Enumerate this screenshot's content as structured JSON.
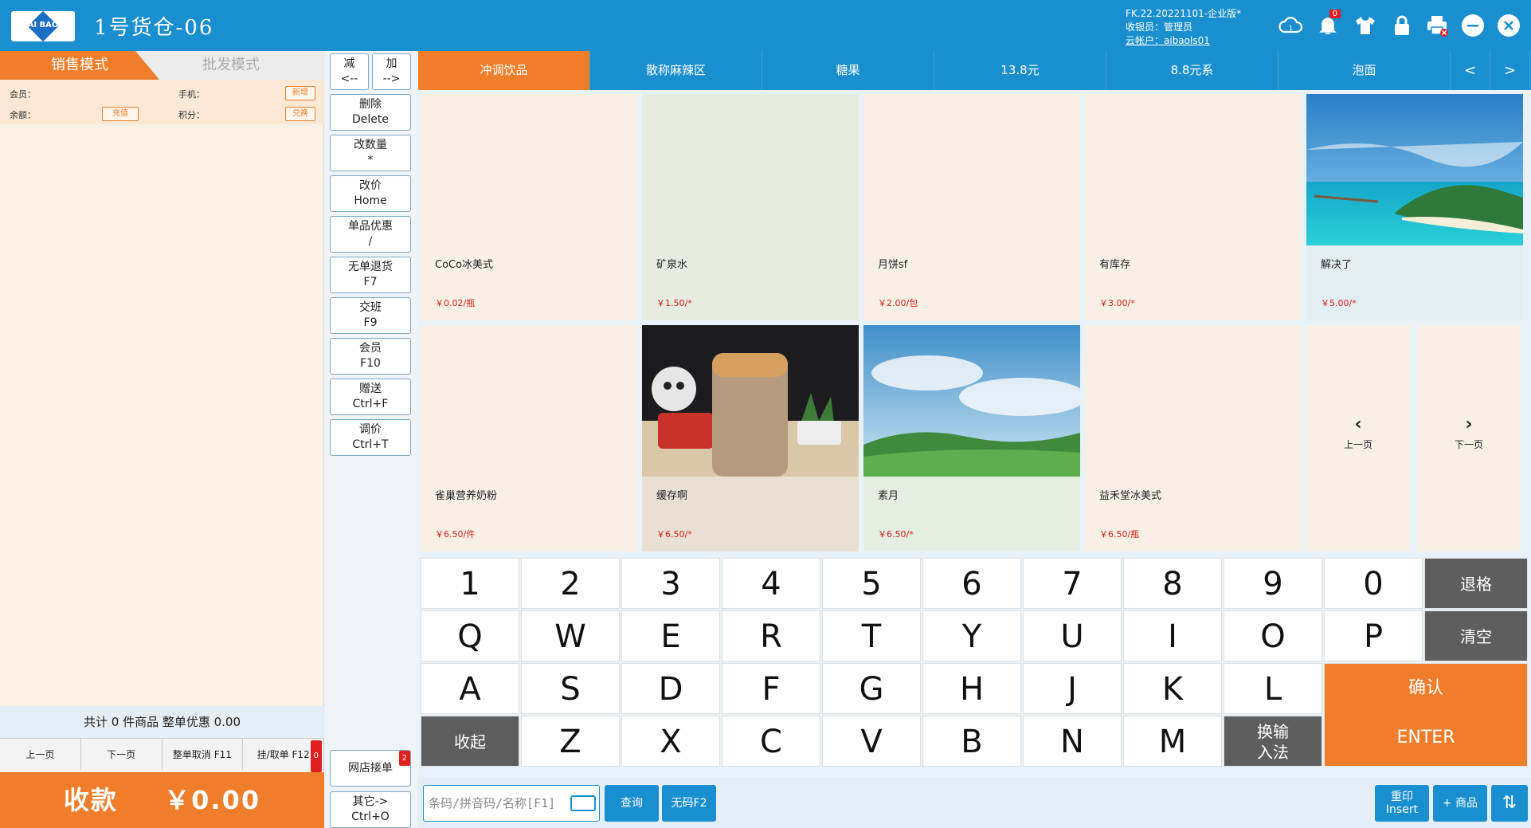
{
  "header": {
    "logo_text": "AI BAO",
    "title": "1号货仓-06",
    "version": "FK.22.20221101-企业版*",
    "cashier": "收银员：管理员",
    "account": "云帐户：aibaols01",
    "notif_count": "0",
    "colors": {
      "primary": "#1a8fcf",
      "accent": "#ef7d2a"
    }
  },
  "left": {
    "tabs": [
      "销售模式",
      "批发模式"
    ],
    "member": {
      "member_label": "会员：",
      "phone_label": "手机：",
      "balance_label": "余额：",
      "points_label": "积分：",
      "add_btn": "新增",
      "recharge_btn": "充值",
      "redeem_btn": "兑换"
    },
    "summary": "共计 0 件商品 整单优惠 0.00",
    "pager": {
      "prev": "上一页",
      "next": "下一页",
      "cancel": "整单取消 F11",
      "hold": "挂/取单 F12",
      "hold_count": "0"
    },
    "pay_label": "收款",
    "pay_amount": "￥0.00"
  },
  "functions": {
    "minus": [
      "减",
      "<--"
    ],
    "plus": [
      "加",
      "-->"
    ],
    "buttons": [
      [
        "删除",
        "Delete"
      ],
      [
        "改数量",
        "*"
      ],
      [
        "改价",
        "Home"
      ],
      [
        "单品优惠",
        "/"
      ],
      [
        "无单退货",
        "F7"
      ],
      [
        "交班",
        "F9"
      ],
      [
        "会员",
        "F10"
      ],
      [
        "赠送",
        "Ctrl+F"
      ],
      [
        "调价",
        "Ctrl+T"
      ]
    ],
    "online_orders": "网店接单",
    "online_count": "2",
    "other": [
      "其它->",
      "Ctrl+O"
    ]
  },
  "categories": [
    "冲调饮品",
    "散称麻辣区",
    "糖果",
    "13.8元",
    "8.8元系",
    "泡面"
  ],
  "cat_nav": {
    "prev": "<",
    "next": ">"
  },
  "products": [
    {
      "name": "CoCo冰美式",
      "price": "￥0.02/瓶",
      "image": "none",
      "bg": "#f8f0e4"
    },
    {
      "name": "矿泉水",
      "price": "￥1.50/*",
      "image": "none",
      "bg": "#e6ecdf"
    },
    {
      "name": "月饼sf",
      "price": "￥2.00/包",
      "image": "none",
      "bg": "#f8f0e4"
    },
    {
      "name": "有库存",
      "price": "￥3.00/*",
      "image": "none",
      "bg": "#f8f0e4"
    },
    {
      "name": "解决了",
      "price": "￥5.00/*",
      "image": "island",
      "bg": "#e3eef2"
    },
    {
      "name": "雀巢营养奶粉",
      "price": "￥6.50/件",
      "image": "none",
      "bg": "#f8f0e4"
    },
    {
      "name": "缓存啊",
      "price": "￥6.50/*",
      "image": "coffee",
      "bg": "#e8e0d4"
    },
    {
      "name": "素月",
      "price": "￥6.50/*",
      "image": "landscape",
      "bg": "#e4efe2"
    },
    {
      "name": "益禾堂冰美式",
      "price": "￥6.50/瓶",
      "image": "none",
      "bg": "#f8f0e4"
    }
  ],
  "grid_nav": {
    "prev": "上一页",
    "next": "下一页"
  },
  "keyboard": {
    "row1": [
      "1",
      "2",
      "3",
      "4",
      "5",
      "6",
      "7",
      "8",
      "9",
      "0"
    ],
    "row2": [
      "Q",
      "W",
      "E",
      "R",
      "T",
      "Y",
      "U",
      "I",
      "O",
      "P"
    ],
    "row3": [
      "A",
      "S",
      "D",
      "F",
      "G",
      "H",
      "J",
      "K",
      "L"
    ],
    "row4": [
      "Z",
      "X",
      "C",
      "V",
      "B",
      "N",
      "M"
    ],
    "backspace": "退格",
    "clear": "清空",
    "collapse": "收起",
    "ime": [
      "换输",
      "入法"
    ],
    "confirm": "确认",
    "enter": "ENTER"
  },
  "bottom": {
    "search_placeholder": "条码/拼音码/名称[F1]",
    "query": "查询",
    "no_code": "无码F2",
    "reprint": [
      "重印",
      "Insert"
    ],
    "add_product": "+ 商品",
    "sort_icon": "sort-icon"
  }
}
